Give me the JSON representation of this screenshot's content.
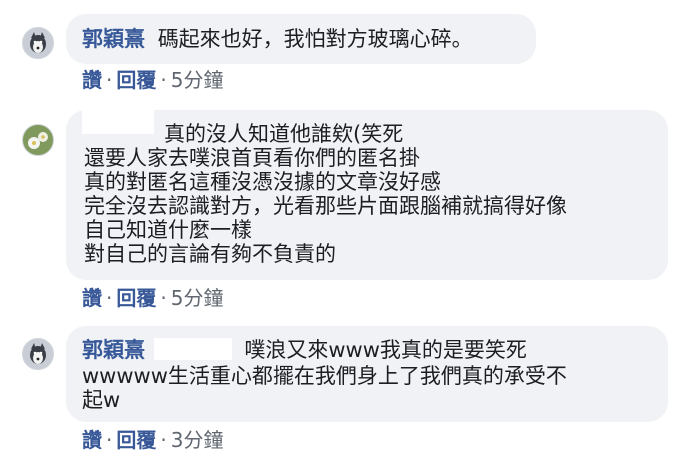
{
  "comments": [
    {
      "author": "郭穎熹",
      "lines": [
        "碼起來也好，我怕對方玻璃心碎。"
      ],
      "actions": {
        "like": "讚",
        "reply": "回覆",
        "time": "5分鐘"
      },
      "avatar_icon": "husky-dog-avatar-icon"
    },
    {
      "author": "",
      "lines": [
        "真的沒人知道他誰欸(笑死",
        "還要人家去噗浪首頁看你們的匿名掛",
        "真的對匿名這種沒憑沒據的文章沒好感",
        "完全沒去認識對方，光看那些片面跟腦補就搞得好像",
        "自己知道什麼一樣",
        "對自己的言論有夠不負責的"
      ],
      "actions": {
        "like": "讚",
        "reply": "回覆",
        "time": "5分鐘"
      },
      "avatar_icon": "flower-avatar-icon"
    },
    {
      "author": "郭穎熹",
      "lines": [
        "噗浪又來www我真的是要笑死",
        "wwwww生活重心都擺在我們身上了我們真的承受不",
        "起w"
      ],
      "actions": {
        "like": "讚",
        "reply": "回覆",
        "time": "3分鐘"
      },
      "avatar_icon": "husky-dog-avatar-icon"
    }
  ],
  "colors": {
    "bubble": "#f0f2f5",
    "link": "#385898",
    "name": "#365899",
    "meta": "#606770"
  }
}
